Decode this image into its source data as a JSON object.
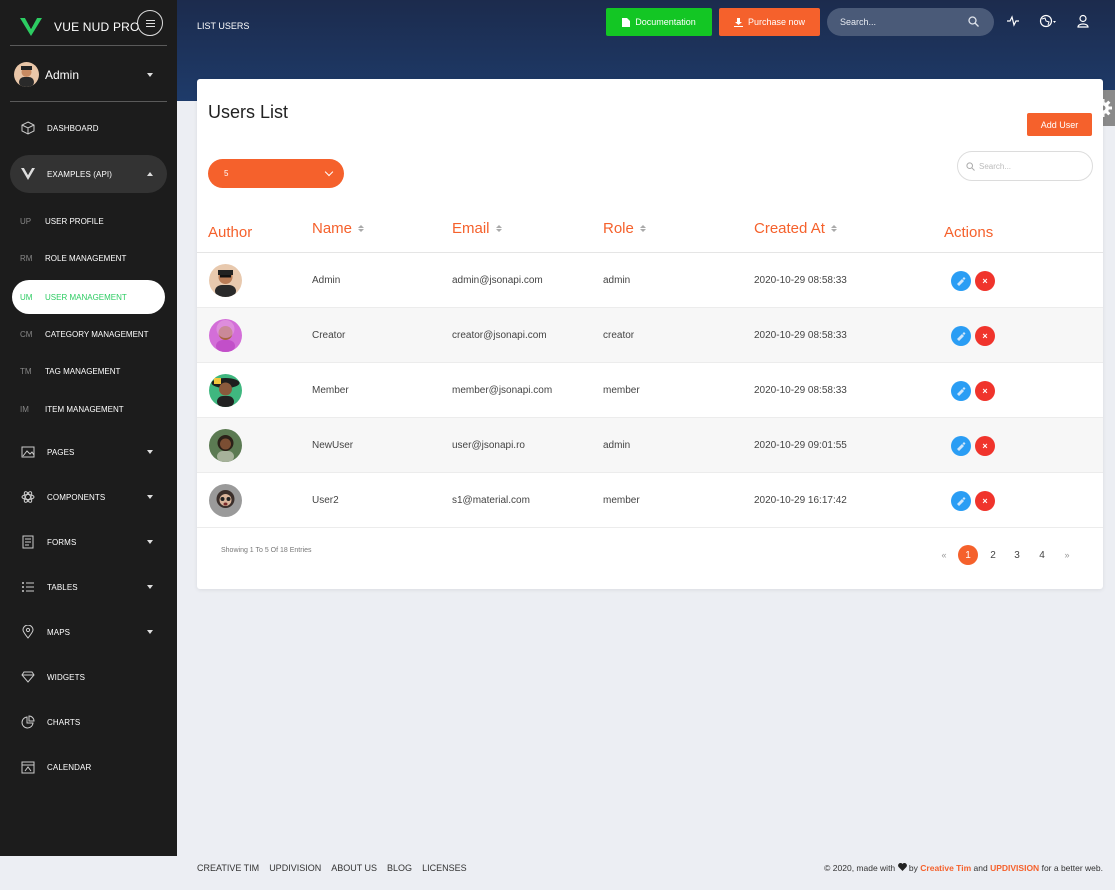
{
  "brand": {
    "name": "VUE NUD PRO"
  },
  "user": {
    "name": "Admin"
  },
  "nav": {
    "dashboard": "DASHBOARD",
    "examples": "EXAMPLES (API)",
    "sub": [
      {
        "abbr": "UP",
        "label": "USER PROFILE"
      },
      {
        "abbr": "RM",
        "label": "ROLE MANAGEMENT"
      },
      {
        "abbr": "UM",
        "label": "USER MANAGEMENT"
      },
      {
        "abbr": "CM",
        "label": "CATEGORY MANAGEMENT"
      },
      {
        "abbr": "TM",
        "label": "TAG MANAGEMENT"
      },
      {
        "abbr": "IM",
        "label": "ITEM MANAGEMENT"
      }
    ],
    "pages": "PAGES",
    "components": "COMPONENTS",
    "forms": "FORMS",
    "tables": "TABLES",
    "maps": "MAPS",
    "widgets": "WIDGETS",
    "charts": "CHARTS",
    "calendar": "CALENDAR"
  },
  "header": {
    "breadcrumb": "LIST USERS",
    "documentation": "Documentation",
    "purchase": "Purchase now",
    "search_placeholder": "Search..."
  },
  "card": {
    "title": "Users List",
    "add_user": "Add User",
    "per_page": "5",
    "search_placeholder": "Search..."
  },
  "table": {
    "headers": {
      "author": "Author",
      "name": "Name",
      "email": "Email",
      "role": "Role",
      "created": "Created At",
      "actions": "Actions"
    },
    "rows": [
      {
        "name": "Admin",
        "email": "admin@jsonapi.com",
        "role": "admin",
        "created": "2020-10-29 08:58:33"
      },
      {
        "name": "Creator",
        "email": "creator@jsonapi.com",
        "role": "creator",
        "created": "2020-10-29 08:58:33"
      },
      {
        "name": "Member",
        "email": "member@jsonapi.com",
        "role": "member",
        "created": "2020-10-29 08:58:33"
      },
      {
        "name": "NewUser",
        "email": "user@jsonapi.ro",
        "role": "admin",
        "created": "2020-10-29 09:01:55"
      },
      {
        "name": "User2",
        "email": "s1@material.com",
        "role": "member",
        "created": "2020-10-29 16:17:42"
      }
    ],
    "delete_symbol": "×"
  },
  "pagination": {
    "showing": "Showing 1 To 5 Of 18 Entries",
    "prev": "«",
    "pages": [
      "1",
      "2",
      "3",
      "4"
    ],
    "next": "»"
  },
  "footer": {
    "links": [
      "CREATIVE TIM",
      "UPDIVISION",
      "ABOUT US",
      "BLOG",
      "LICENSES"
    ],
    "copy_pre": "© 2020, made with",
    "copy_by": "by",
    "brand1": "Creative Tim",
    "copy_and": "and",
    "brand2": "UPDIVISION",
    "copy_post": "for a better web."
  },
  "colors": {
    "accent": "#f5612c",
    "success": "#13c624",
    "sidebar": "#1c1c1c",
    "active_sub": "#2ccc62",
    "edit": "#2a9df4",
    "delete": "#f0342c"
  },
  "icons": [
    "vue-logo-icon",
    "menu-icon",
    "box-icon",
    "vue-icon",
    "image-icon",
    "atom-icon",
    "form-icon",
    "list-icon",
    "pin-icon",
    "diamond-icon",
    "chart-pie-icon",
    "calendar-icon",
    "document-icon",
    "download-icon",
    "search-icon",
    "activity-icon",
    "globe-icon",
    "user-icon",
    "gear-icon",
    "edit-icon",
    "close-icon",
    "heart-icon"
  ]
}
